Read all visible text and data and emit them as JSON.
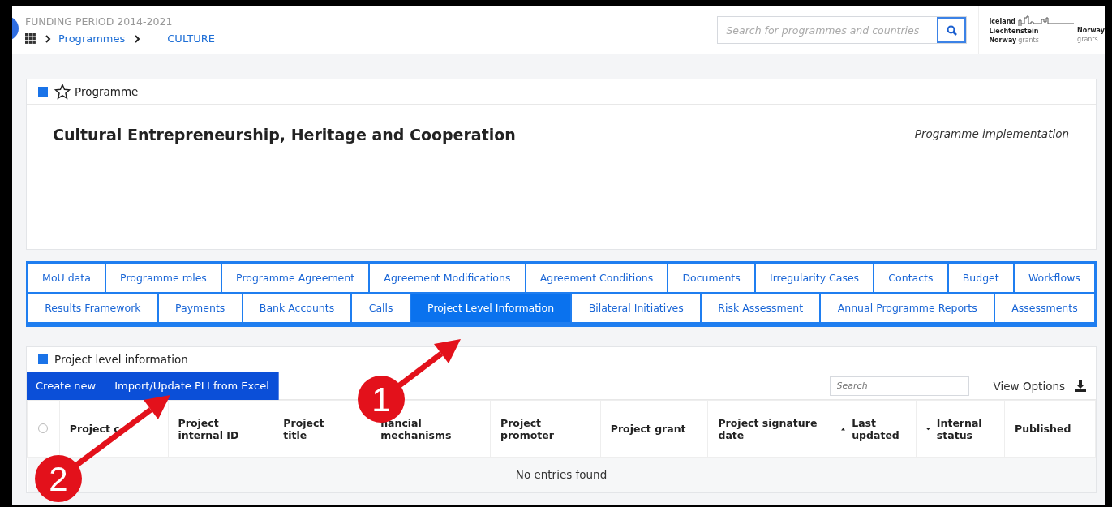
{
  "header": {
    "period": "FUNDING PERIOD 2014-2021",
    "breadcrumb": [
      "Programmes",
      "CULTURE"
    ],
    "search": {
      "placeholder": "Search for programmes and countries"
    },
    "logo": {
      "line_1": "Iceland",
      "line_2": "Liechtenstein",
      "line_3_bold": "Norway",
      "line_3": "grants",
      "right_1": "Norway",
      "right_2": "grants"
    }
  },
  "programme_card": {
    "label": "Programme",
    "starred": false,
    "title": "Cultural Entrepreneurship, Heritage and Cooperation",
    "status": "Programme implementation"
  },
  "tabs": [
    [
      {
        "label": "MoU data",
        "selected": false
      },
      {
        "label": "Programme roles",
        "selected": false
      },
      {
        "label": "Programme Agreement",
        "selected": false
      },
      {
        "label": "Agreement Modifications",
        "selected": false
      },
      {
        "label": "Agreement Conditions",
        "selected": false
      },
      {
        "label": "Documents",
        "selected": false
      },
      {
        "label": "Irregularity Cases",
        "selected": false
      },
      {
        "label": "Contacts",
        "selected": false
      },
      {
        "label": "Budget",
        "selected": false
      },
      {
        "label": "Workflows",
        "selected": false
      }
    ],
    [
      {
        "label": "Results Framework",
        "selected": false
      },
      {
        "label": "Payments",
        "selected": false
      },
      {
        "label": "Bank Accounts",
        "selected": false
      },
      {
        "label": "Calls",
        "selected": false
      },
      {
        "label": "Project Level Information",
        "selected": true
      },
      {
        "label": "Bilateral Initiatives",
        "selected": false
      },
      {
        "label": "Risk Assessment",
        "selected": false
      },
      {
        "label": "Annual Programme Reports",
        "selected": false
      },
      {
        "label": "Assessments",
        "selected": false
      }
    ]
  ],
  "pli_card": {
    "label": "Project level information",
    "buttons": [
      "Create new",
      "Import/Update PLI from Excel"
    ],
    "search": {
      "placeholder": "Search"
    },
    "view_options": "View Options",
    "table": {
      "select_all_checked": false,
      "columns": [
        {
          "label": "Project c"
        },
        {
          "label": "Project internal ID"
        },
        {
          "label": "Project title"
        },
        {
          "label": "nancial mechanisms"
        },
        {
          "label": "Project promoter"
        },
        {
          "label": "Project grant"
        },
        {
          "label": "Project signature date"
        },
        {
          "label": "Last updated",
          "sort_up": true,
          "sort_down": false
        },
        {
          "label": "Internal status",
          "sort_up": false,
          "sort_down": true
        },
        {
          "label": "Published"
        }
      ],
      "empty_message": "No entries found"
    }
  },
  "annotations": [
    {
      "number": "1"
    },
    {
      "number": "2"
    }
  ]
}
